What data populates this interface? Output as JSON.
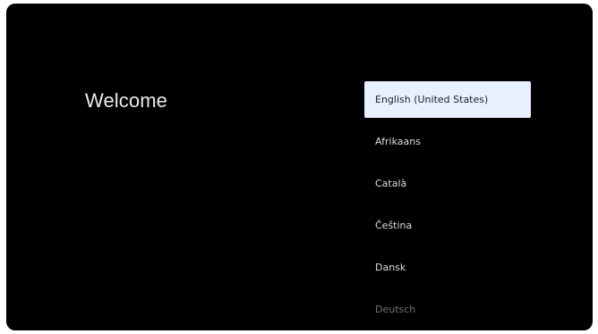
{
  "welcome": {
    "title": "Welcome"
  },
  "languages": {
    "items": [
      {
        "label": "English (United States)",
        "selected": true
      },
      {
        "label": "Afrikaans",
        "selected": false
      },
      {
        "label": "Català",
        "selected": false
      },
      {
        "label": "Čeština",
        "selected": false
      },
      {
        "label": "Dansk",
        "selected": false
      },
      {
        "label": "Deutsch",
        "selected": false
      }
    ]
  },
  "colors": {
    "background": "#000000",
    "selected_background": "#e8f0fe",
    "text": "#dadce0"
  }
}
